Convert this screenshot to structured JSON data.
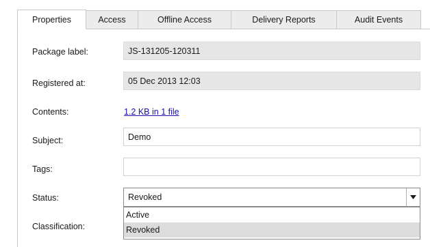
{
  "tabs": [
    {
      "label": "Properties"
    },
    {
      "label": "Access"
    },
    {
      "label": "Offline Access"
    },
    {
      "label": "Delivery Reports"
    },
    {
      "label": "Audit Events"
    }
  ],
  "form": {
    "package_label": {
      "label": "Package label:",
      "value": "JS-131205-120311"
    },
    "registered_at": {
      "label": "Registered at:",
      "value": "05 Dec 2013 12:03"
    },
    "contents": {
      "label": "Contents:",
      "link_text": "1.2 KB in 1 file"
    },
    "subject": {
      "label": "Subject:",
      "value": "Demo"
    },
    "tags": {
      "label": "Tags:",
      "value": ""
    },
    "status": {
      "label": "Status:",
      "selected": "Revoked",
      "options": [
        "Active",
        "Revoked"
      ]
    },
    "classification": {
      "label": "Classification:"
    }
  },
  "colors": {
    "readonly_bg": "#e6e6e6",
    "link": "#1a0dab",
    "selected_option_bg": "#dcdcdc"
  }
}
